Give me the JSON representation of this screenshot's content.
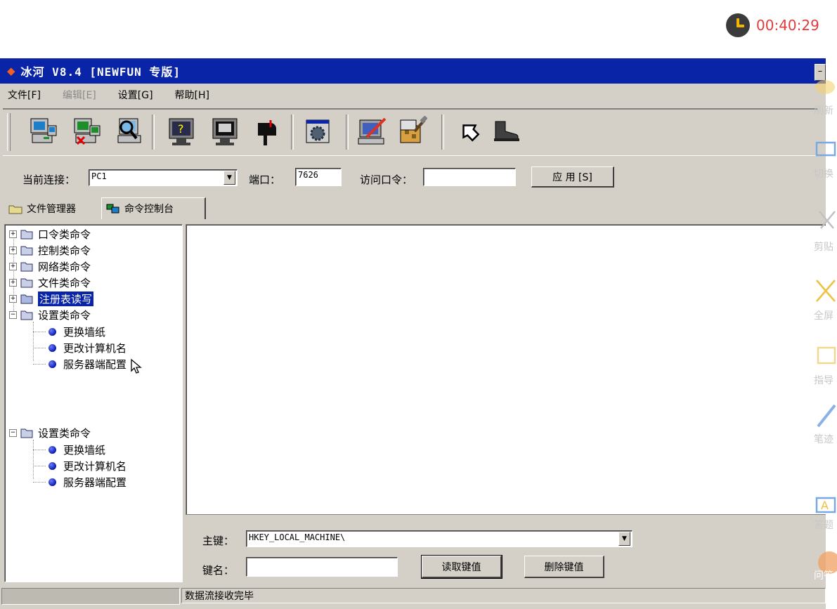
{
  "clock": {
    "time": "00:40:29"
  },
  "window": {
    "title": "冰河 V8.4 [NEWFUN 专版]"
  },
  "menu": [
    {
      "label": "文件[F]",
      "enabled": true
    },
    {
      "label": "编辑[E]",
      "enabled": false
    },
    {
      "label": "设置[G]",
      "enabled": true
    },
    {
      "label": "帮助[H]",
      "enabled": true
    }
  ],
  "connection": {
    "current_label": "当前连接：",
    "current_value": "PC1",
    "port_label": "端口：",
    "port_value": "7626",
    "password_label": "访问口令：",
    "password_value": "",
    "apply_button": "应 用 [S]"
  },
  "tabs": [
    {
      "label": "文件管理器",
      "active": false
    },
    {
      "label": "命令控制台",
      "active": true
    }
  ],
  "tree": {
    "group1": [
      {
        "label": "口令类命令"
      },
      {
        "label": "控制类命令"
      },
      {
        "label": "网络类命令"
      },
      {
        "label": "文件类命令"
      },
      {
        "label": "注册表读写",
        "selected": true
      },
      {
        "label": "设置类命令",
        "expanded": true
      }
    ],
    "group1_children": [
      "更换墙纸",
      "更改计算机名",
      "服务器端配置"
    ],
    "group2_parent": "设置类命令",
    "group2_children": [
      "更换墙纸",
      "更改计算机名",
      "服务器端配置"
    ]
  },
  "registry": {
    "key_label": "主键：",
    "key_value": "HKEY_LOCAL_MACHINE\\",
    "name_label": "键名：",
    "name_value": "",
    "read_button": "读取键值",
    "delete_button": "删除键值"
  },
  "status": {
    "message": "数据流接收完毕"
  },
  "side_toolbar": [
    "刷新",
    "切换",
    "剪贴",
    "全屏",
    "指导",
    "笔迹",
    "答题",
    "问答"
  ],
  "colors": {
    "titlebar": "#0a24a8",
    "clock_text": "#e23b3b",
    "clock_hand": "#f4b400"
  }
}
